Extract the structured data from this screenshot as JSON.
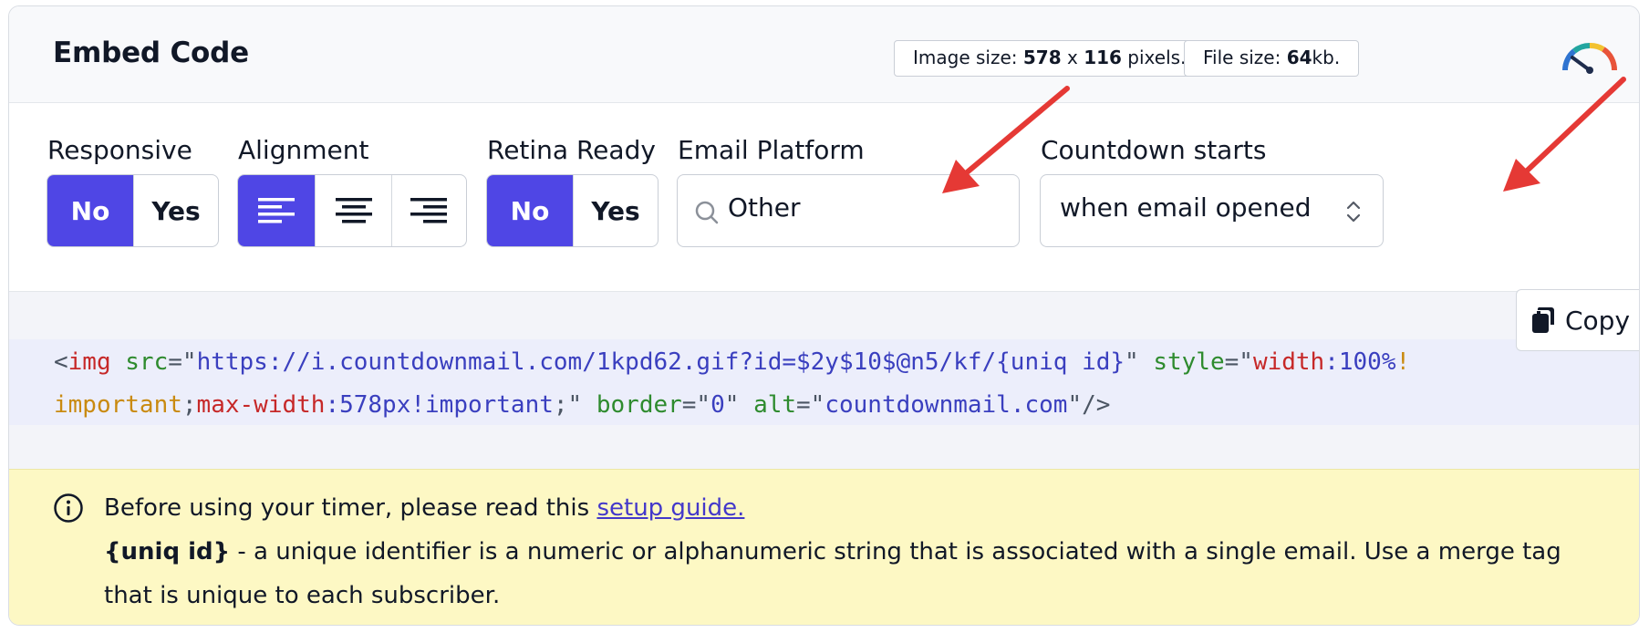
{
  "header": {
    "title": "Embed Code",
    "image_size": {
      "label": "Image size:",
      "width": "578",
      "separator": "x",
      "height": "116",
      "unit": "pixels."
    },
    "file_size": {
      "label": "File size:",
      "value": "64",
      "unit": "kb."
    },
    "speed_icon": "gauge-icon"
  },
  "options": {
    "responsive": {
      "label": "Responsive",
      "options": [
        "No",
        "Yes"
      ],
      "selected": "No"
    },
    "alignment": {
      "label": "Alignment",
      "options": [
        "align-left-icon",
        "align-center-icon",
        "align-right-icon"
      ],
      "selected": "align-left-icon"
    },
    "retina": {
      "label": "Retina Ready",
      "options": [
        "No",
        "Yes"
      ],
      "selected": "No"
    },
    "email_platform": {
      "label": "Email Platform",
      "value": "Other",
      "icon": "search-icon"
    },
    "countdown_starts": {
      "label": "Countdown starts",
      "value": "when email opened",
      "icon": "chevron-updown-icon"
    }
  },
  "code": {
    "tokens_line1": [
      {
        "t": "<",
        "c": "punc"
      },
      {
        "t": "img",
        "c": "tag"
      },
      {
        "t": " ",
        "c": "punc"
      },
      {
        "t": "src",
        "c": "attr"
      },
      {
        "t": "=\"",
        "c": "punc"
      },
      {
        "t": "https://i.countdownmail.com/1kpd62.gif?id=$2y$10$@n5/kf/{uniq id}",
        "c": "str"
      },
      {
        "t": "\" ",
        "c": "punc"
      },
      {
        "t": "style",
        "c": "attr"
      },
      {
        "t": "=\"",
        "c": "punc"
      },
      {
        "t": "width",
        "c": "prop"
      },
      {
        "t": ":100%",
        "c": "str"
      },
      {
        "t": "!",
        "c": "imp"
      }
    ],
    "tokens_line2": [
      {
        "t": "important",
        "c": "imp"
      },
      {
        "t": ";",
        "c": "punc"
      },
      {
        "t": "max-width",
        "c": "prop"
      },
      {
        "t": ":578px!important",
        "c": "str"
      },
      {
        "t": ";\" ",
        "c": "punc"
      },
      {
        "t": "border",
        "c": "attr"
      },
      {
        "t": "=\"",
        "c": "punc"
      },
      {
        "t": "0",
        "c": "str"
      },
      {
        "t": "\" ",
        "c": "punc"
      },
      {
        "t": "alt",
        "c": "attr"
      },
      {
        "t": "=\"",
        "c": "punc"
      },
      {
        "t": "countdownmail.com",
        "c": "str"
      },
      {
        "t": "\"/>",
        "c": "punc"
      }
    ],
    "copy_label": "Copy",
    "copy_icon": "copy-icon"
  },
  "notice": {
    "icon": "info-icon",
    "text_before_link": "Before using your timer, please read this ",
    "link_text": "setup guide.",
    "term": "{uniq id}",
    "description": " - a unique identifier is a numeric or alphanumeric string that is associated with a single email. Use a merge tag that is unique to each subscriber."
  },
  "colors": {
    "accent": "#4f46e5",
    "notice_bg": "#fdf8c4",
    "arrow": "#e53935"
  }
}
